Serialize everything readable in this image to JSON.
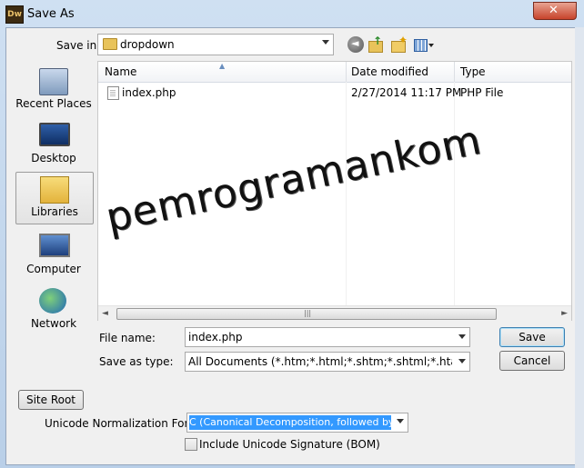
{
  "window": {
    "title": "Save As",
    "app_icon_text": "Dw"
  },
  "toolbar": {
    "save_in_label": "Save in:",
    "save_in_value": "dropdown",
    "back_icon": "back-arrow-icon",
    "up_icon": "up-folder-icon",
    "new_folder_icon": "new-folder-icon",
    "view_icon": "view-menu-icon"
  },
  "places": [
    {
      "label": "Recent Places",
      "icon": "recent-places-icon"
    },
    {
      "label": "Desktop",
      "icon": "desktop-icon"
    },
    {
      "label": "Libraries",
      "icon": "libraries-icon",
      "selected": true
    },
    {
      "label": "Computer",
      "icon": "computer-icon"
    },
    {
      "label": "Network",
      "icon": "network-icon"
    }
  ],
  "file_list": {
    "columns": [
      "Name",
      "Date modified",
      "Type"
    ],
    "rows": [
      {
        "name": "index.php",
        "date_modified": "2/27/2014 11:17 PM",
        "type": "PHP File"
      }
    ],
    "watermark": "pemrogramankom"
  },
  "form": {
    "file_name_label": "File name:",
    "file_name_value": "index.php",
    "save_as_type_label": "Save as type:",
    "save_as_type_value": "All Documents (*.htm;*.html;*.shtm;*.shtml;*.hta;*.htc;*.xhtml;*.s",
    "save_button": "Save",
    "cancel_button": "Cancel",
    "site_root_button": "Site Root",
    "unicode_label": "Unicode Normalization Form:",
    "unicode_value": "C (Canonical Decomposition, followed by Canc",
    "bom_label": "Include Unicode Signature (BOM)",
    "bom_checked": false
  },
  "colors": {
    "selection": "#3399ff",
    "close_button": "#c7432b"
  }
}
